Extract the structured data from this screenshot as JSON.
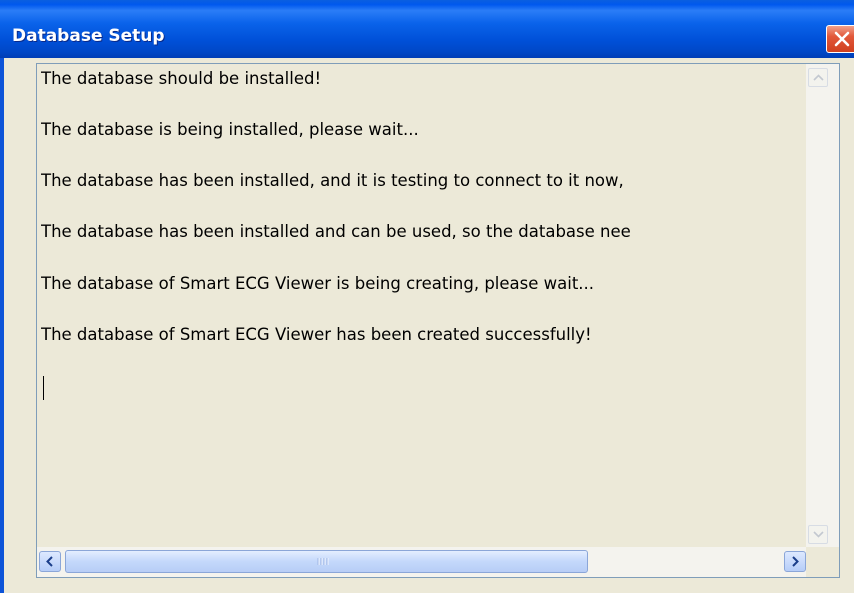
{
  "window": {
    "title": "Database Setup",
    "close_icon": "close-icon"
  },
  "log": {
    "lines": [
      "The database should be installed!",
      "The database is being installed, please wait...",
      "The database has been installed, and it is testing to connect to it now,",
      "The database has been installed and can be used, so the database nee",
      "The database of Smart ECG Viewer is being creating, please wait...",
      "The database of Smart ECG Viewer has been created successfully!"
    ]
  },
  "scrollbars": {
    "up_icon": "scroll-up-arrow-icon",
    "down_icon": "scroll-down-arrow-icon",
    "left_icon": "scroll-left-arrow-icon",
    "right_icon": "scroll-right-arrow-icon",
    "grip_icon": "scroll-grip-icon"
  },
  "colors": {
    "titlebar": "#0054E3",
    "window_bg": "#ECE9D8",
    "close_button": "#D94A2A"
  }
}
